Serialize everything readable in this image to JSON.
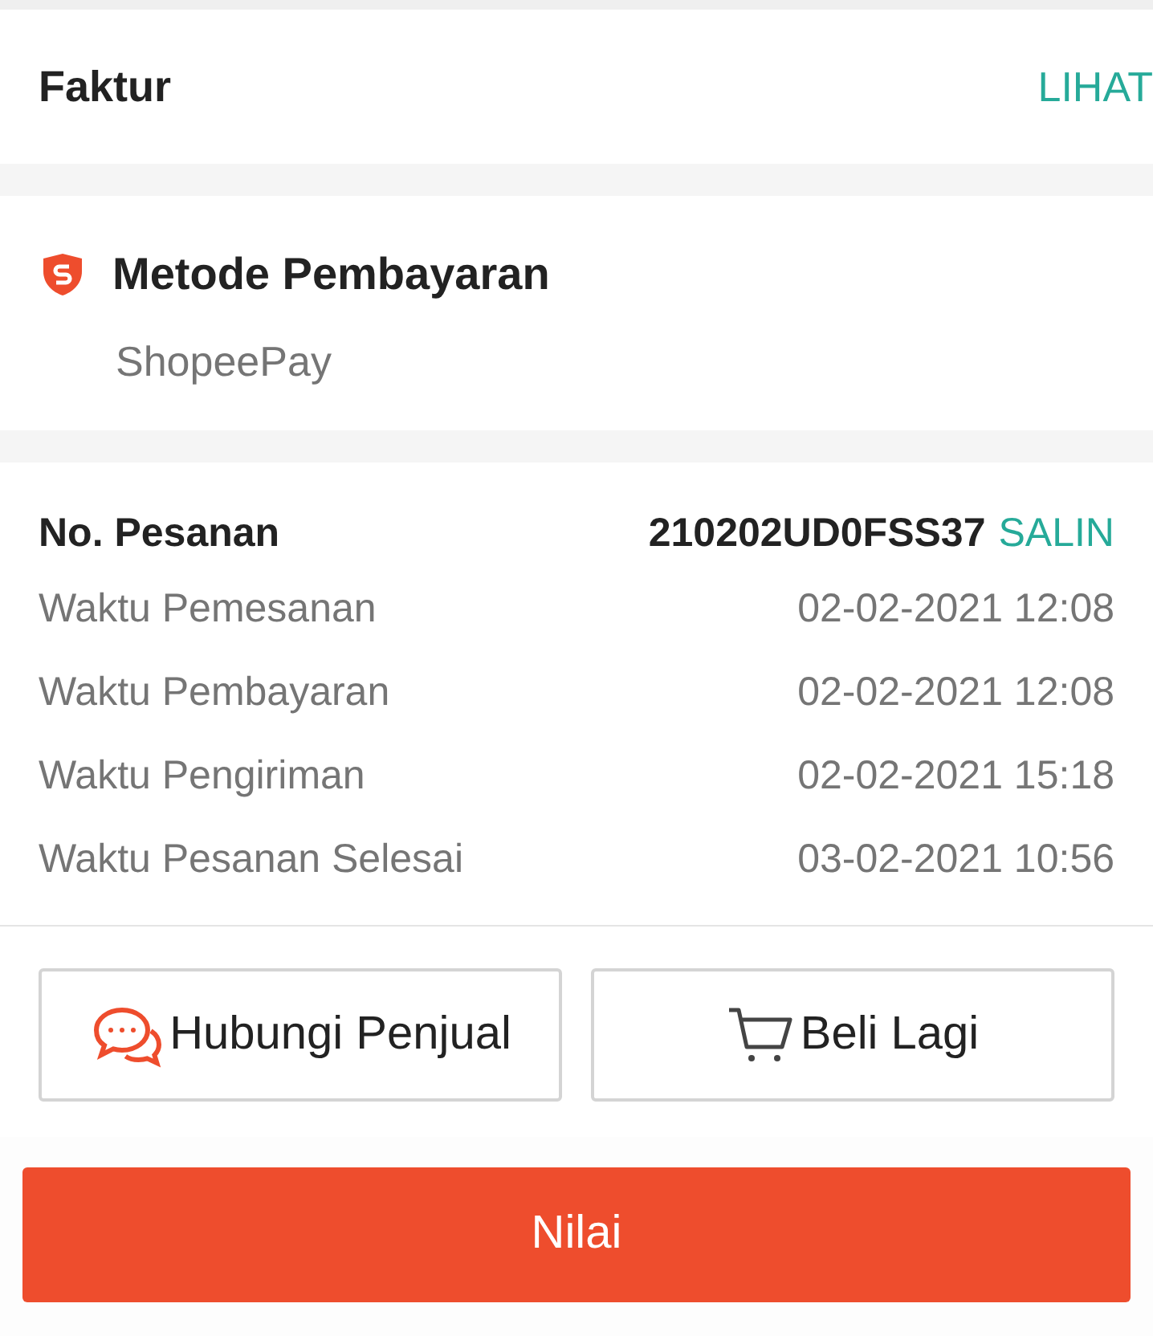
{
  "invoice": {
    "title": "Faktur",
    "link": "LIHAT"
  },
  "payment": {
    "title": "Metode Pembayaran",
    "method": "ShopeePay"
  },
  "order": {
    "number_label": "No. Pesanan",
    "number": "210202UD0FSS37",
    "copy": "SALIN",
    "times": [
      {
        "label": "Waktu Pemesanan",
        "value": "02-02-2021 12:08"
      },
      {
        "label": "Waktu Pembayaran",
        "value": "02-02-2021 12:08"
      },
      {
        "label": "Waktu Pengiriman",
        "value": "02-02-2021 15:18"
      },
      {
        "label": "Waktu Pesanan Selesai",
        "value": "03-02-2021 10:56"
      }
    ]
  },
  "actions": [
    {
      "kind": "chat",
      "label": "Hubungi Penjual"
    },
    {
      "kind": "cart",
      "label": "Beli Lagi"
    }
  ],
  "primary_button": "Nilai"
}
